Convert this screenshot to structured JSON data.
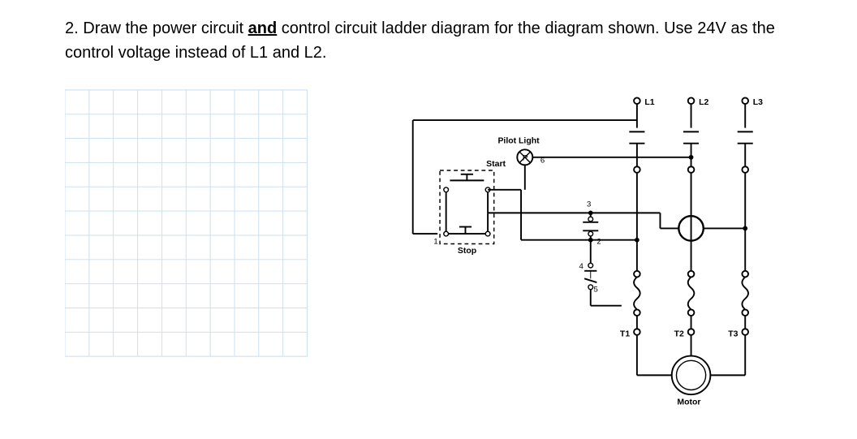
{
  "question": {
    "number": "2.",
    "text_part1": "Draw the power circuit ",
    "text_underlined": "and",
    "text_part2": " control circuit ladder diagram for the diagram shown. Use 24V as the control voltage instead of L1 and L2."
  },
  "circuit": {
    "power_lines": [
      "L1",
      "L2",
      "L3"
    ],
    "terminals": [
      "T1",
      "T2",
      "T3"
    ],
    "motor_label": "Motor",
    "pilot_light_label": "Pilot Light",
    "pilot_light_letter": "R",
    "start_label": "Start",
    "stop_label": "Stop",
    "node_numbers": [
      "1",
      "2",
      "3",
      "4",
      "5",
      "6"
    ]
  }
}
